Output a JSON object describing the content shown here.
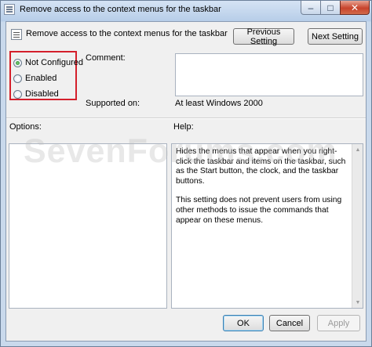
{
  "window": {
    "title": "Remove access to the context menus for the taskbar",
    "minimize_glyph": "–",
    "maximize_glyph": "□",
    "close_glyph": "✕"
  },
  "policy": {
    "title": "Remove access to the context menus for the taskbar"
  },
  "navigation": {
    "previous_label": "Previous Setting",
    "next_label": "Next Setting"
  },
  "state": {
    "options": [
      {
        "label": "Not Configured",
        "checked": true
      },
      {
        "label": "Enabled",
        "checked": false
      },
      {
        "label": "Disabled",
        "checked": false
      }
    ],
    "highlight_color": "#d41f2b"
  },
  "comment": {
    "label": "Comment:",
    "value": ""
  },
  "supported": {
    "label": "Supported on:",
    "value": "At least Windows 2000"
  },
  "options_panel": {
    "label": "Options:"
  },
  "help_panel": {
    "label": "Help:",
    "paragraphs": [
      "Hides the menus that appear when you right-click the taskbar and items on the taskbar, such as the Start button, the clock, and the taskbar buttons.",
      "This setting does not prevent users from using other methods to issue the commands that appear on these menus."
    ]
  },
  "watermark": "SevenForums.com",
  "footer": {
    "ok_label": "OK",
    "cancel_label": "Cancel",
    "apply_label": "Apply"
  },
  "icons": {
    "title": "policy-document-icon",
    "policy": "policy-document-icon",
    "scroll_up": "▲",
    "scroll_down": "▼"
  }
}
